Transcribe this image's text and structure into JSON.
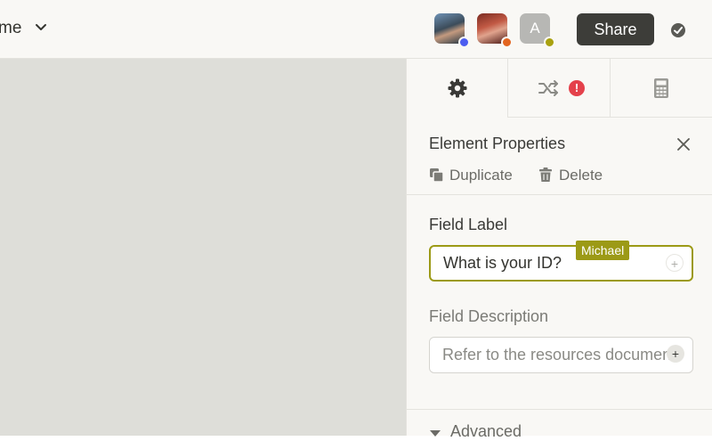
{
  "header": {
    "doc_name": "me",
    "share_label": "Share",
    "collaborators": [
      {
        "initial": "",
        "status_color": "#4c5df0"
      },
      {
        "initial": "",
        "status_color": "#e2641f"
      },
      {
        "initial": "A",
        "status_color": "#a9a10f"
      }
    ]
  },
  "panel": {
    "tabs": [
      {
        "icon": "gear-icon"
      },
      {
        "icon": "shuffle-icon",
        "badge": "!"
      },
      {
        "icon": "calculator-icon"
      }
    ],
    "title": "Element Properties",
    "actions": {
      "duplicate": "Duplicate",
      "delete": "Delete"
    },
    "field_label": {
      "label": "Field Label",
      "value": "What is your ID?",
      "presence_user": "Michael"
    },
    "field_description": {
      "label": "Field Description",
      "placeholder": "Refer to the resources document"
    },
    "advanced_label": "Advanced"
  },
  "colors": {
    "accent_presence": "#9c9a16",
    "alert": "#e4414b",
    "share_bg": "#3d3d39"
  }
}
